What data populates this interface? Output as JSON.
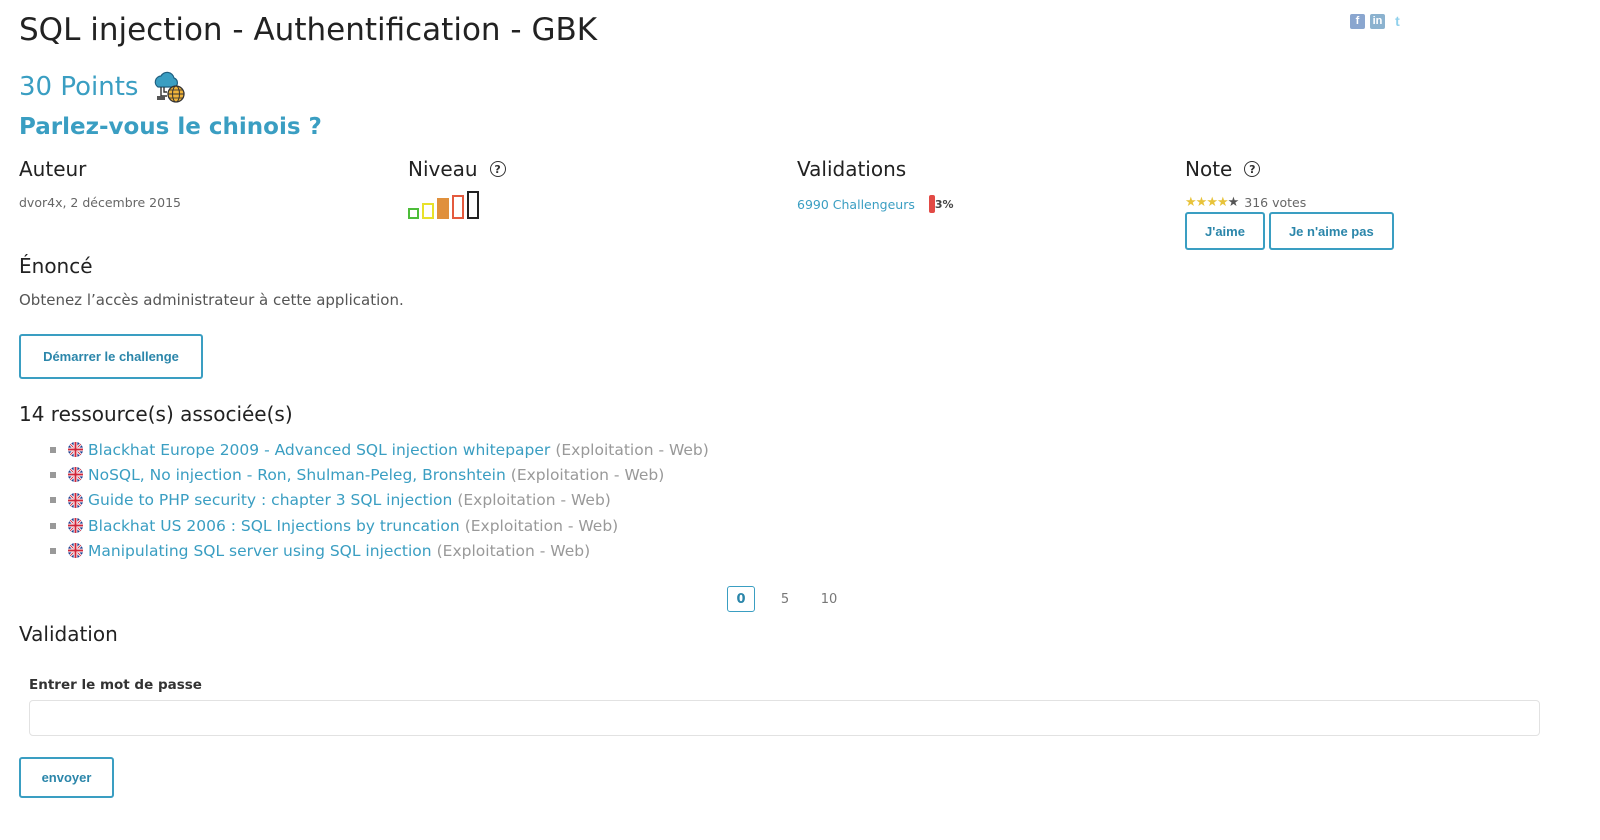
{
  "challenge": {
    "title": "SQL injection - Authentification - GBK",
    "points": "30 Points",
    "subtitle": "Parlez-vous le chinois ?"
  },
  "share": {
    "facebook": "f",
    "linkedin": "in",
    "twitter": "t"
  },
  "info": {
    "author_heading": "Auteur",
    "author": "dvor4x,  2 décembre 2015",
    "level_heading": "Niveau",
    "level": 3,
    "level_max": 5,
    "validations_heading": "Validations",
    "challengers": "6990 Challengeurs",
    "percent": "3%",
    "note_heading": "Note",
    "stars": 4,
    "stars_max": 5,
    "votes": "316 votes",
    "like_label": "J'aime",
    "dislike_label": "Je n'aime pas"
  },
  "statement": {
    "heading": "Énoncé",
    "text": "Obtenez l’accès administrateur à cette application.",
    "start_label": "Démarrer le challenge"
  },
  "resources": {
    "heading": "14 ressource(s) associée(s)",
    "items": [
      {
        "title": "Blackhat Europe 2009 - Advanced SQL injection whitepaper",
        "category": "(Exploitation - Web)"
      },
      {
        "title": "NoSQL, No injection - Ron, Shulman-Peleg, Bronshtein",
        "category": "(Exploitation - Web)"
      },
      {
        "title": "Guide to PHP security : chapter 3 SQL injection",
        "category": "(Exploitation - Web)"
      },
      {
        "title": "Blackhat US 2006 : SQL Injections by truncation",
        "category": "(Exploitation - Web)"
      },
      {
        "title": "Manipulating SQL server using SQL injection",
        "category": "(Exploitation - Web)"
      }
    ]
  },
  "pagination": {
    "pages": [
      "0",
      "5",
      "10"
    ],
    "active": "0"
  },
  "validation": {
    "heading": "Validation",
    "password_label": "Entrer le mot de passe",
    "password_value": "",
    "submit_label": "envoyer"
  },
  "colors": {
    "accent": "#3a9ec2",
    "text": "#222222",
    "muted": "#999999",
    "percent_bar": "#e24a45"
  }
}
